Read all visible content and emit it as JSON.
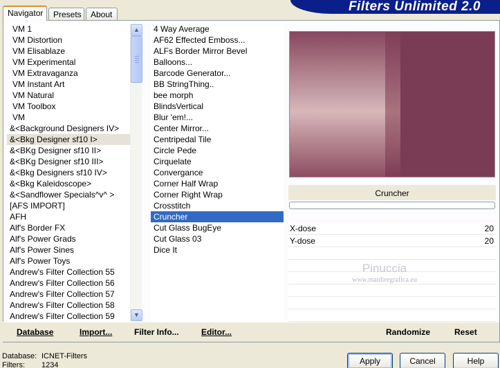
{
  "tabs": [
    "Navigator",
    "Presets",
    "About"
  ],
  "banner": "Filters Unlimited 2.0",
  "categories": [
    "VM 1",
    "VM Distortion",
    "VM Elisablaze",
    "VM Experimental",
    "VM Extravaganza",
    "VM Instant Art",
    "VM Natural",
    "VM Toolbox",
    "VM",
    "&<Background Designers IV>",
    "&<Bkg Designer sf10 I>",
    "&<BKg Designer sf10 II>",
    "&<BKg Designer sf10 III>",
    "&<Bkg Designers sf10 IV>",
    "&<Bkg Kaleidoscope>",
    "&<Sandflower Specials^v^ >",
    "[AFS IMPORT]",
    "AFH",
    "Alf's Border FX",
    "Alf's Power Grads",
    "Alf's Power Sines",
    "Alf's Power Toys",
    "Andrew's Filter Collection 55",
    "Andrew's Filter Collection 56",
    "Andrew's Filter Collection 57",
    "Andrew's Filter Collection 58",
    "Andrew's Filter Collection 59"
  ],
  "filters": [
    "4 Way Average",
    "AF62 Effected Emboss...",
    "ALFs Border Mirror Bevel",
    "Balloons...",
    "Barcode Generator...",
    "BB StringThing..",
    "bee morph",
    "BlindsVertical",
    "Blur 'em!...",
    "Center Mirror...",
    "Centripedal Tile",
    "Circle Pede",
    "Cirquelate",
    "Convergance",
    "Corner Half Wrap",
    "Corner Right Wrap",
    "Crosstitch",
    "Cruncher",
    "Cut Glass  BugEye",
    "Cut Glass 03",
    "Dice It"
  ],
  "selected_filter": "Cruncher",
  "params": [
    {
      "name": "X-dose",
      "value": "20"
    },
    {
      "name": "Y-dose",
      "value": "20"
    }
  ],
  "watermark": "Pinuccia",
  "watermark_url": "www.maidiregrafica.eu",
  "bottom_buttons": {
    "database": "Database",
    "import": "Import...",
    "filter_info": "Filter Info...",
    "editor": "Editor...",
    "randomize": "Randomize",
    "reset": "Reset"
  },
  "footer": {
    "database_label": "Database:",
    "database_value": "ICNET-Filters",
    "filters_label": "Filters:",
    "filters_value": "1234"
  },
  "dialog_buttons": {
    "apply": "Apply",
    "cancel": "Cancel",
    "help": "Help"
  },
  "colors": {
    "selection": "#316ac5",
    "banner": "#0a1f8a",
    "preview_dark": "#7a3b55"
  }
}
